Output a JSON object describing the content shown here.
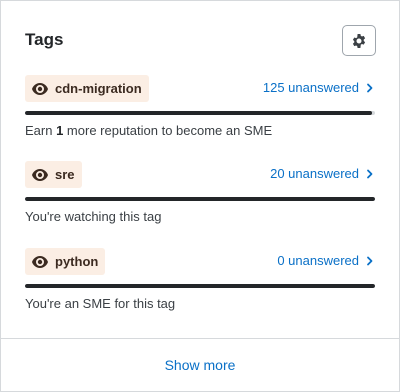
{
  "header": {
    "title": "Tags",
    "settings_icon": "gear-icon"
  },
  "tags": [
    {
      "name": "cdn-migration",
      "icon": "eye-icon",
      "unanswered": "125 unanswered",
      "progress": 0.99,
      "status_prefix": "Earn ",
      "status_bold": "1",
      "status_suffix": " more reputation to become an SME"
    },
    {
      "name": "sre",
      "icon": "eye-icon",
      "unanswered": "20 unanswered",
      "progress": 1.0,
      "status": "You're watching this tag"
    },
    {
      "name": "python",
      "icon": "eye-icon",
      "unanswered": "0 unanswered",
      "progress": 1.0,
      "status": "You're an SME for this tag"
    }
  ],
  "footer": {
    "show_more_label": "Show more"
  },
  "colors": {
    "chip_bg": "#fbeee4",
    "link": "#0a70c7",
    "progress_fill": "#232629",
    "progress_track": "#d6d9dc"
  }
}
